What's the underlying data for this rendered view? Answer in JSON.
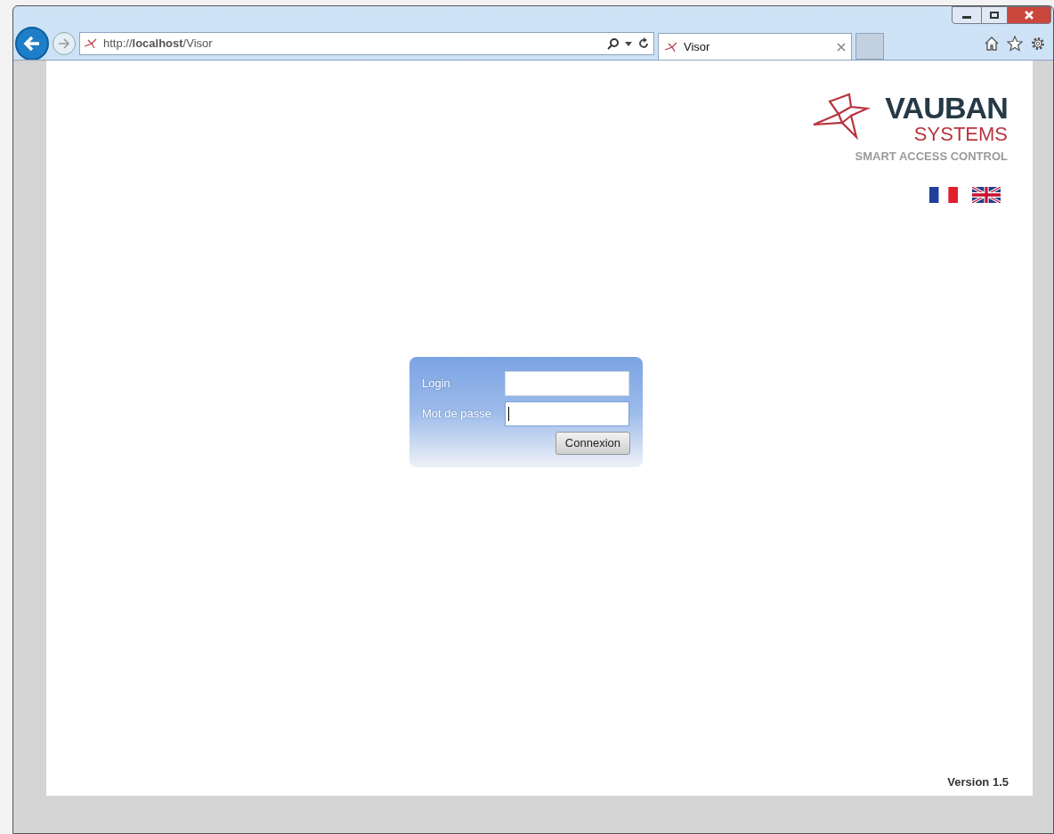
{
  "browser": {
    "address": "http://**localhost**/Visor",
    "tabs": [
      {
        "title": "Visor",
        "selected": true
      }
    ]
  },
  "logo": {
    "name": "VAUBAN",
    "sub": "SYSTEMS",
    "tagline": "SMART ACCESS CONTROL"
  },
  "login_form": {
    "fields": [
      {
        "label": "Login",
        "focused": false
      },
      {
        "label": "Mot de passe",
        "focused": true
      }
    ],
    "submit": "Connexion"
  },
  "footer": {
    "version": "Version 1.5"
  }
}
